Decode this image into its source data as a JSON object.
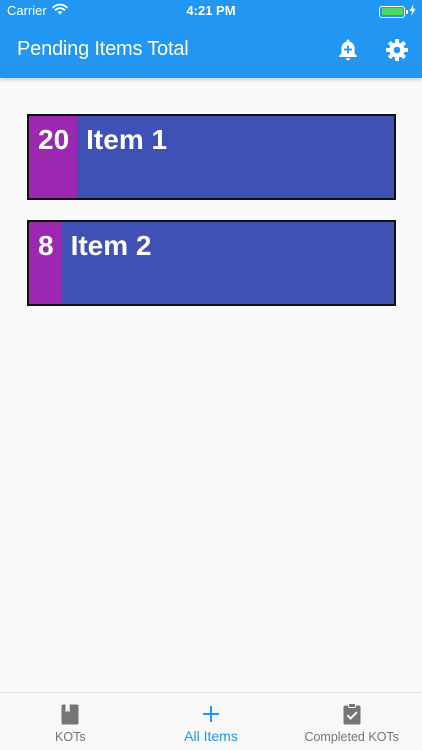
{
  "status_bar": {
    "carrier": "Carrier",
    "time": "4:21 PM"
  },
  "app_bar": {
    "title": "Pending Items Total"
  },
  "items": [
    {
      "quantity": "20",
      "name": "Item 1"
    },
    {
      "quantity": "8",
      "name": "Item 2"
    }
  ],
  "bottom_nav": {
    "tabs": [
      {
        "label": "KOTs",
        "icon": "book-icon",
        "active": false
      },
      {
        "label": "All Items",
        "icon": "plus-icon",
        "active": true
      },
      {
        "label": "Completed KOTs",
        "icon": "clipboard-check-icon",
        "active": false
      }
    ]
  },
  "colors": {
    "primary": "#2196f3",
    "card_background": "#3f51b5",
    "quantity_background": "#9c27b0",
    "battery": "#4cd964"
  }
}
